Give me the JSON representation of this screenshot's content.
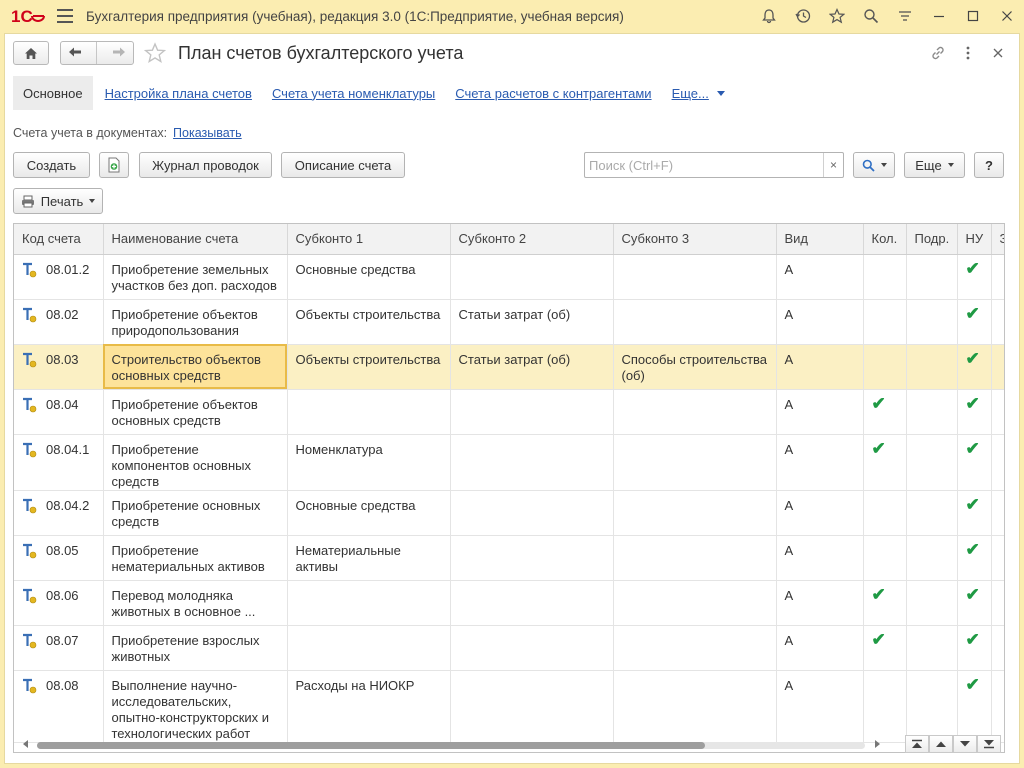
{
  "app": {
    "title": "Бухгалтерия предприятия (учебная), редакция 3.0  (1С:Предприятие, учебная версия)"
  },
  "header": {
    "title": "План счетов бухгалтерского учета"
  },
  "tabs": [
    {
      "label": "Основное"
    },
    {
      "label": "Настройка плана счетов"
    },
    {
      "label": "Счета учета номенклатуры"
    },
    {
      "label": "Счета расчетов с контрагентами"
    },
    {
      "label": "Еще..."
    }
  ],
  "accounts_in_docs": {
    "label": "Счета учета в документах:",
    "link": "Показывать"
  },
  "toolbar": {
    "create": "Создать",
    "journal": "Журнал проводок",
    "description": "Описание счета",
    "search_placeholder": "Поиск (Ctrl+F)",
    "clear": "×",
    "more": "Еще",
    "help": "?",
    "print": "Печать"
  },
  "columns": [
    "Код счета",
    "Наименование счета",
    "Субконто 1",
    "Субконто 2",
    "Субконто 3",
    "Вид",
    "Кол.",
    "Подр.",
    "НУ",
    "З"
  ],
  "rows": [
    {
      "code": "08.01.2",
      "name": "Приобретение земельных участков без доп. расходов",
      "sub1": "Основные средства",
      "sub2": "",
      "sub3": "",
      "kind": "А",
      "qty": false,
      "dept": false,
      "nu": true
    },
    {
      "code": "08.02",
      "name": "Приобретение объектов природопользования",
      "sub1": "Объекты строительства",
      "sub2": "Статьи затрат (об)",
      "sub3": "",
      "kind": "А",
      "qty": false,
      "dept": false,
      "nu": true
    },
    {
      "code": "08.03",
      "name": "Строительство объектов основных средств",
      "sub1": "Объекты строительства",
      "sub2": "Статьи затрат (об)",
      "sub3": "Способы строительства (об)",
      "kind": "А",
      "qty": false,
      "dept": false,
      "nu": true,
      "selected": true
    },
    {
      "code": "08.04",
      "name": "Приобретение объектов основных средств",
      "sub1": "",
      "sub2": "",
      "sub3": "",
      "kind": "А",
      "qty": true,
      "dept": false,
      "nu": true
    },
    {
      "code": "08.04.1",
      "name": "Приобретение компонентов основных средств",
      "sub1": "Номенклатура",
      "sub2": "",
      "sub3": "",
      "kind": "А",
      "qty": true,
      "dept": false,
      "nu": true
    },
    {
      "code": "08.04.2",
      "name": "Приобретение основных средств",
      "sub1": "Основные средства",
      "sub2": "",
      "sub3": "",
      "kind": "А",
      "qty": false,
      "dept": false,
      "nu": true
    },
    {
      "code": "08.05",
      "name": "Приобретение нематериальных активов",
      "sub1": "Нематериальные активы",
      "sub2": "",
      "sub3": "",
      "kind": "А",
      "qty": false,
      "dept": false,
      "nu": true
    },
    {
      "code": "08.06",
      "name": "Перевод молодняка животных в основное ...",
      "sub1": "",
      "sub2": "",
      "sub3": "",
      "kind": "А",
      "qty": true,
      "dept": false,
      "nu": true
    },
    {
      "code": "08.07",
      "name": "Приобретение взрослых животных",
      "sub1": "",
      "sub2": "",
      "sub3": "",
      "kind": "А",
      "qty": true,
      "dept": false,
      "nu": true
    },
    {
      "code": "08.08",
      "name": "Выполнение научно-исследовательских, опытно-конструкторских и технологических работ",
      "sub1": "Расходы на НИОКР",
      "sub2": "",
      "sub3": "",
      "kind": "А",
      "qty": false,
      "dept": false,
      "nu": true
    }
  ],
  "colors": {
    "accent": "#fbedb1",
    "link": "#2a5bb0",
    "check": "#1f9a44",
    "selected_row": "#fbf0c4",
    "focus_cell": "#fde39a"
  },
  "icons": [
    "logo-1c",
    "hamburger-icon",
    "bell-icon",
    "history-icon",
    "star-icon",
    "search-icon",
    "filter-icon",
    "minimize-icon",
    "maximize-icon",
    "close-icon",
    "home-icon",
    "back-icon",
    "forward-icon",
    "link-icon",
    "kebab-icon",
    "add-copy-icon",
    "printer-icon",
    "account-t-icon",
    "checkmark-icon"
  ]
}
